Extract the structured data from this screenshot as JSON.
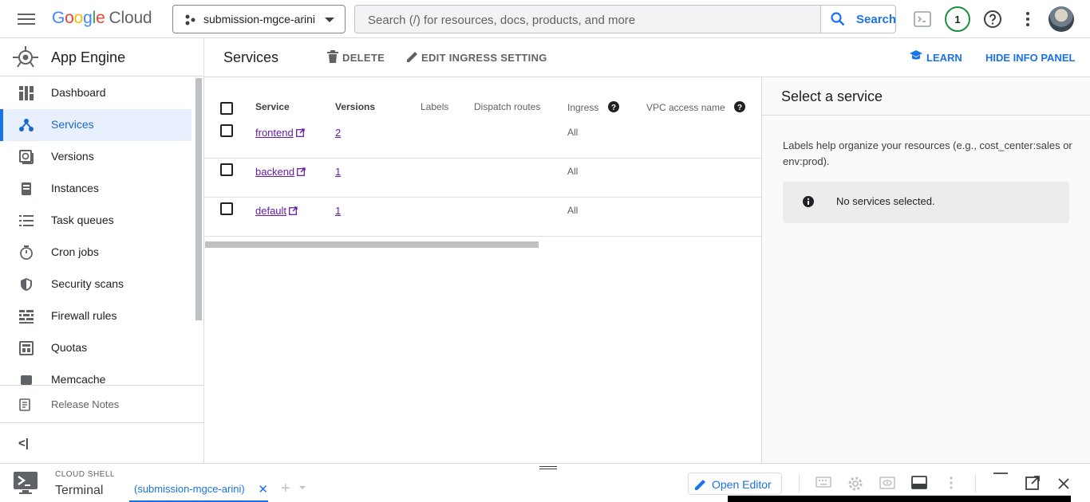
{
  "topbar": {
    "logo_letters": [
      "G",
      "o",
      "o",
      "g",
      "l",
      "e"
    ],
    "logo_cloud": "Cloud",
    "project_name": "submission-mgce-arini",
    "search_placeholder": "Search (/) for resources, docs, products, and more",
    "search_button": "Search",
    "notification_count": "1"
  },
  "sidebar": {
    "app_title": "App Engine",
    "items": [
      {
        "label": "Dashboard",
        "icon": "dashboard-icon"
      },
      {
        "label": "Services",
        "icon": "services-icon",
        "active": true
      },
      {
        "label": "Versions",
        "icon": "versions-icon"
      },
      {
        "label": "Instances",
        "icon": "instances-icon"
      },
      {
        "label": "Task queues",
        "icon": "task-queues-icon"
      },
      {
        "label": "Cron jobs",
        "icon": "cron-jobs-icon"
      },
      {
        "label": "Security scans",
        "icon": "security-scans-icon"
      },
      {
        "label": "Firewall rules",
        "icon": "firewall-rules-icon"
      },
      {
        "label": "Quotas",
        "icon": "quotas-icon"
      },
      {
        "label": "Memcache",
        "icon": "memcache-icon"
      }
    ],
    "release_notes": "Release Notes",
    "collapse_glyph": "<|"
  },
  "header": {
    "title": "Services",
    "delete": "DELETE",
    "edit_ingress": "EDIT INGRESS SETTING",
    "learn": "LEARN",
    "hide_info": "HIDE INFO PANEL"
  },
  "table": {
    "columns": [
      "Service",
      "Versions",
      "Labels",
      "Dispatch routes",
      "Ingress",
      "VPC access name"
    ],
    "rows": [
      {
        "service": "frontend",
        "versions": "2",
        "ingress": "All"
      },
      {
        "service": "backend",
        "versions": "1",
        "ingress": "All"
      },
      {
        "service": "default",
        "versions": "1",
        "ingress": "All"
      }
    ]
  },
  "info_panel": {
    "title": "Select a service",
    "description": "Labels help organize your resources (e.g., cost_center:sales or env:prod).",
    "note": "No services selected."
  },
  "cloud_shell": {
    "caption": "CLOUD SHELL",
    "terminal": "Terminal",
    "tab_label": "(submission-mgce-arini)",
    "tab_close": "✕",
    "add_tab": "+",
    "open_editor": "Open Editor"
  },
  "colors": {
    "accent": "#1a73e8",
    "link_visited": "#681da8",
    "active_bg": "#e8f0fe"
  }
}
